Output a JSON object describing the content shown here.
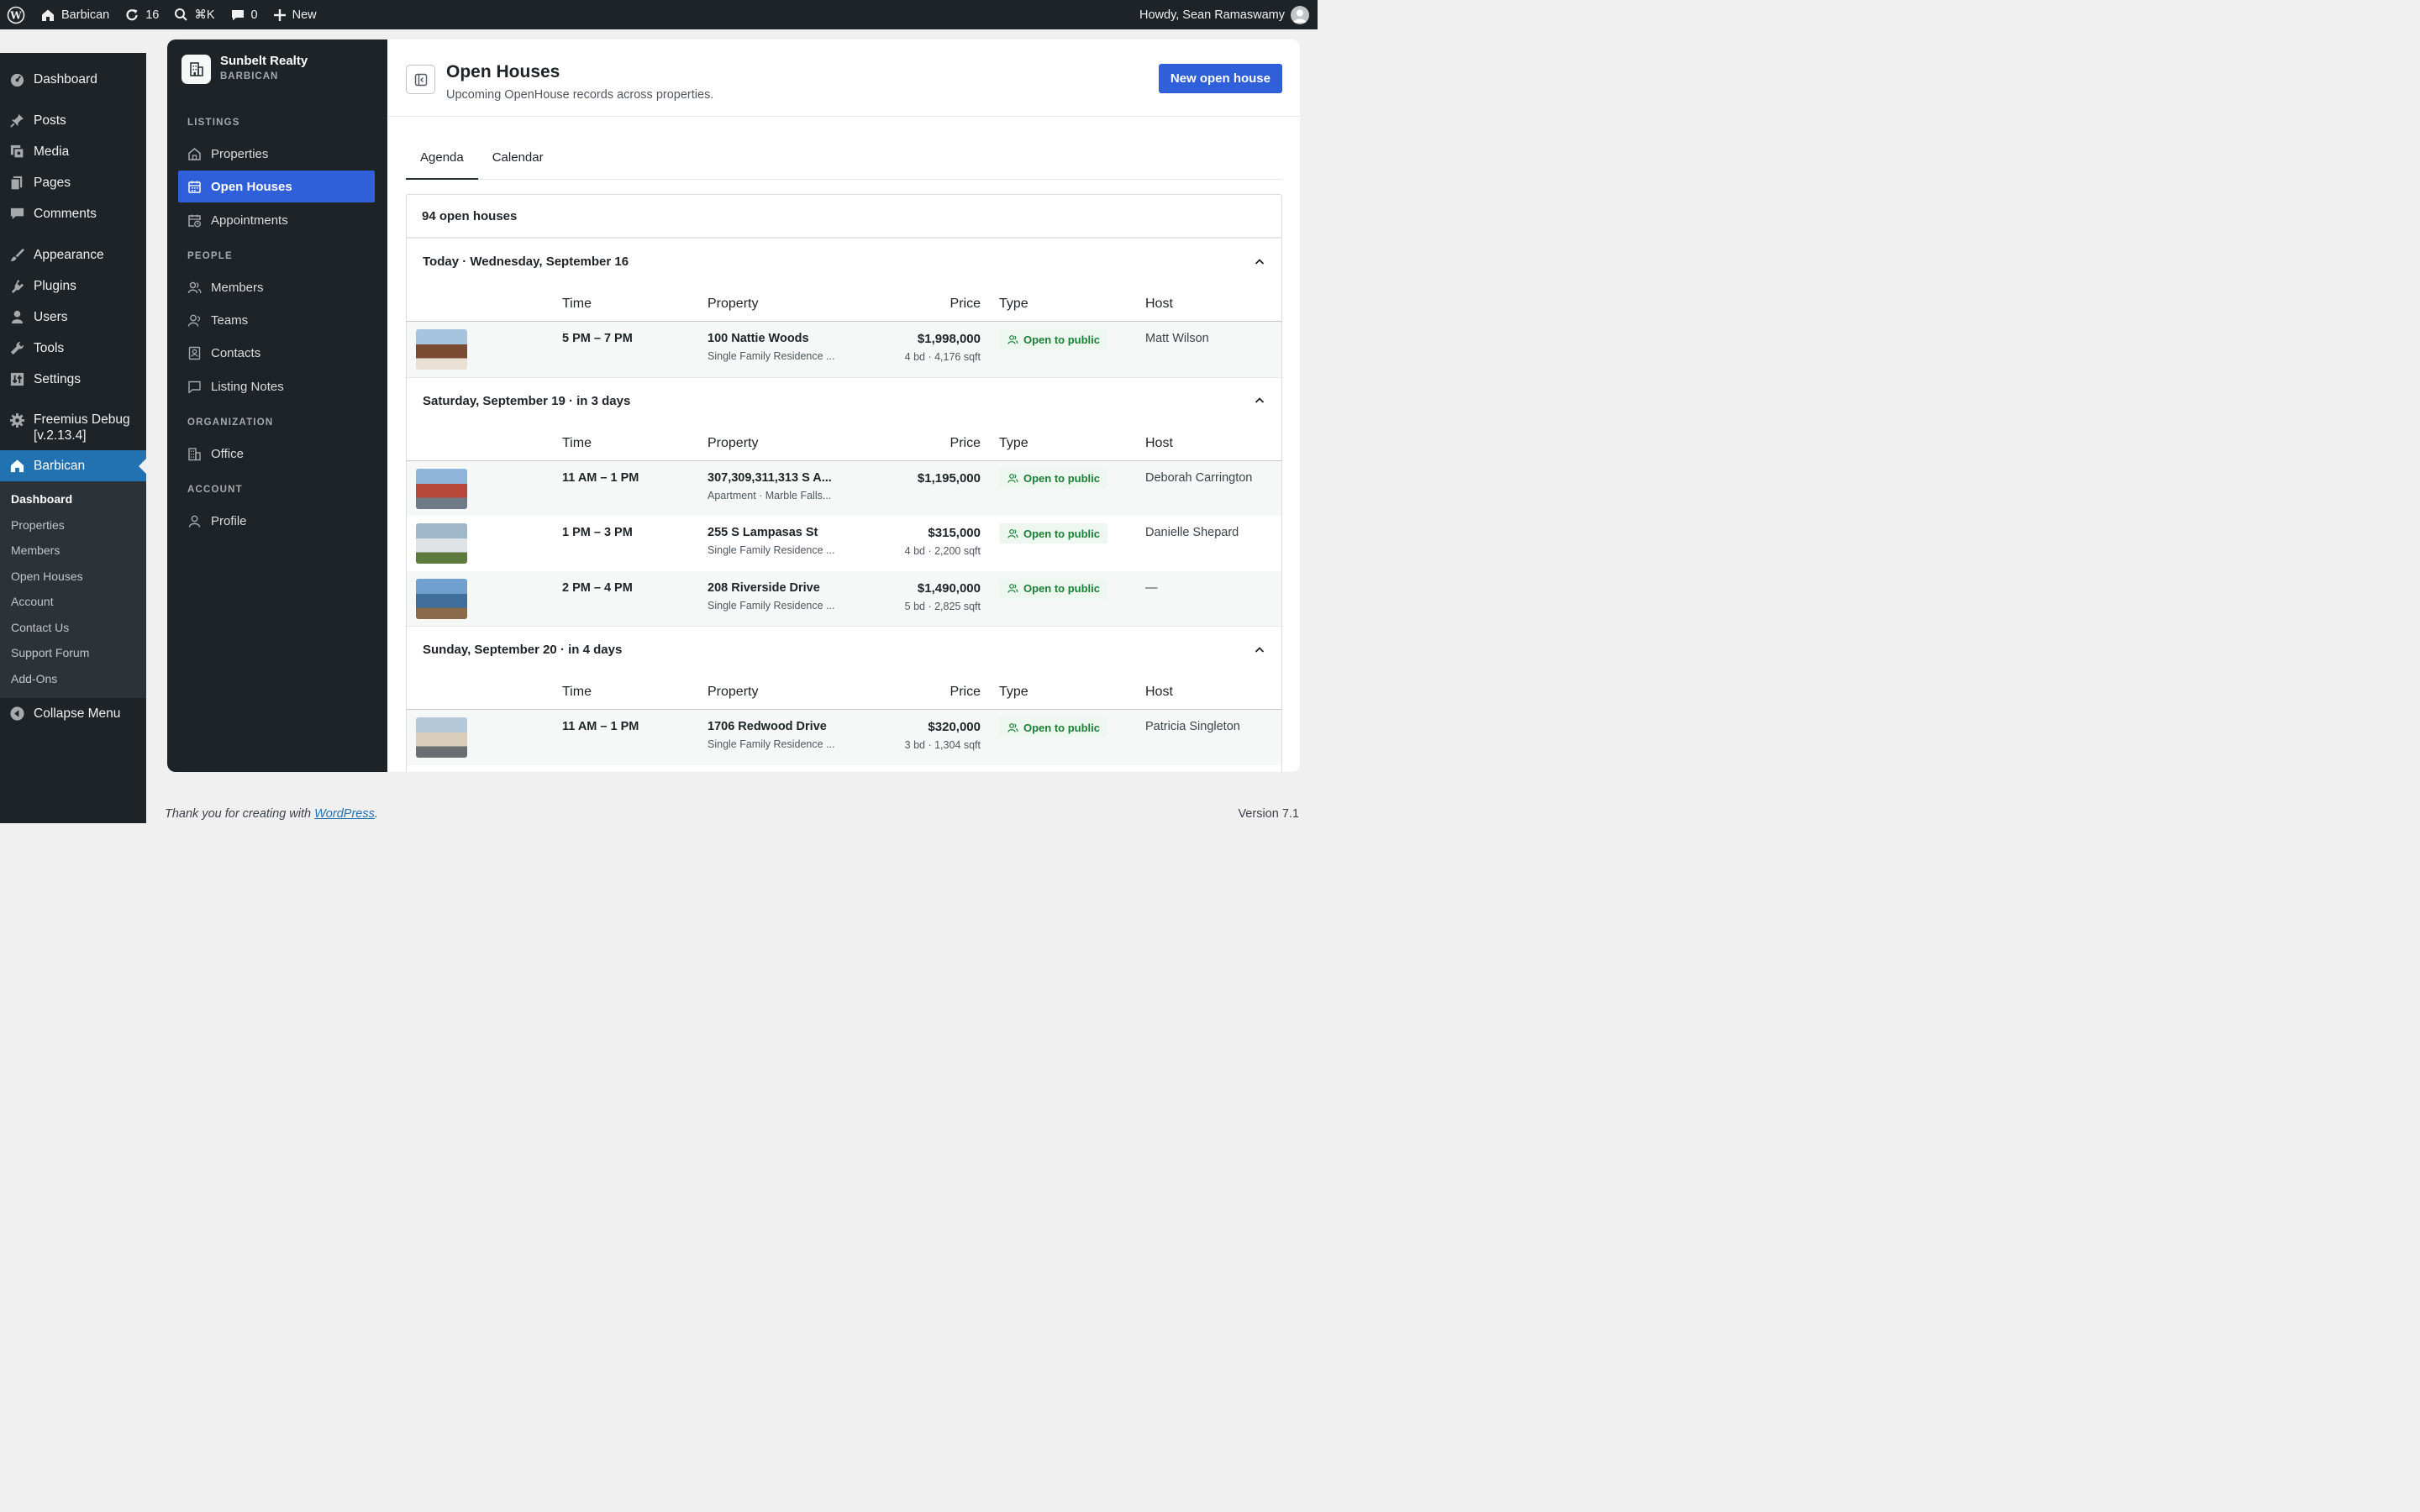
{
  "adminbar": {
    "site_name": "Barbican",
    "updates_count": "16",
    "search_shortcut": "⌘K",
    "comments_count": "0",
    "new_label": "New",
    "howdy": "Howdy, Sean Ramaswamy"
  },
  "wp_menu": {
    "items": [
      "Dashboard",
      "Posts",
      "Media",
      "Pages",
      "Comments",
      "Appearance",
      "Plugins",
      "Users",
      "Tools",
      "Settings"
    ],
    "freemius_line1": "Freemius Debug",
    "freemius_line2": "[v.2.13.4]",
    "current": "Barbican",
    "submenu": [
      "Dashboard",
      "Properties",
      "Members",
      "Open Houses",
      "Account",
      "Contact Us",
      "Support Forum",
      "Add-Ons"
    ],
    "collapse": "Collapse Menu"
  },
  "app_nav": {
    "brand_name": "Sunbelt Realty",
    "brand_sub": "BARBICAN",
    "sections": {
      "listings": "LISTINGS",
      "people": "PEOPLE",
      "organization": "ORGANIZATION",
      "account": "ACCOUNT"
    },
    "items": {
      "properties": "Properties",
      "open_houses": "Open Houses",
      "appointments": "Appointments",
      "members": "Members",
      "teams": "Teams",
      "contacts": "Contacts",
      "listing_notes": "Listing Notes",
      "office": "Office",
      "profile": "Profile"
    }
  },
  "header": {
    "title": "Open Houses",
    "subtitle": "Upcoming OpenHouse records across properties.",
    "new_button": "New open house"
  },
  "tabs": [
    "Agenda",
    "Calendar"
  ],
  "agenda": {
    "count_label": "94 open houses",
    "columns": {
      "time": "Time",
      "property": "Property",
      "price": "Price",
      "type": "Type",
      "host": "Host"
    },
    "groups": [
      {
        "label": "Today · Wednesday, September 16",
        "rows": [
          {
            "time": "5 PM – 7 PM",
            "property": "100 Nattie Woods",
            "property_sub": "Single Family Residence ...",
            "price": "$1,998,000",
            "price_sub": "4 bd · 4,176 sqft",
            "type": "Open to public",
            "host": "Matt Wilson"
          }
        ]
      },
      {
        "label": "Saturday, September 19 · in 3 days",
        "rows": [
          {
            "time": "11 AM – 1 PM",
            "property": "307,309,311,313 S A...",
            "property_sub": "Apartment · Marble Falls...",
            "price": "$1,195,000",
            "price_sub": "",
            "type": "Open to public",
            "host": "Deborah Carrington"
          },
          {
            "time": "1 PM – 3 PM",
            "property": "255 S Lampasas St",
            "property_sub": "Single Family Residence ...",
            "price": "$315,000",
            "price_sub": "4 bd · 2,200 sqft",
            "type": "Open to public",
            "host": "Danielle Shepard"
          },
          {
            "time": "2 PM – 4 PM",
            "property": "208 Riverside Drive",
            "property_sub": "Single Family Residence ...",
            "price": "$1,490,000",
            "price_sub": "5 bd · 2,825 sqft",
            "type": "Open to public",
            "host": "—"
          }
        ]
      },
      {
        "label": "Sunday, September 20 · in 4 days",
        "rows": [
          {
            "time": "11 AM – 1 PM",
            "property": "1706 Redwood Drive",
            "property_sub": "Single Family Residence ...",
            "price": "$320,000",
            "price_sub": "3 bd · 1,304 sqft",
            "type": "Open to public",
            "host": "Patricia Singleton"
          }
        ]
      }
    ]
  },
  "footer": {
    "thanks_prefix": "Thank you for creating with ",
    "wordpress_link": "WordPress",
    "thanks_suffix": ".",
    "version": "Version 7.1"
  },
  "colors": {
    "accent": "#2f5fd9",
    "wp_dark": "#1d2327",
    "wp_blue": "#2271b1",
    "badge_green": "#1a7f37"
  }
}
